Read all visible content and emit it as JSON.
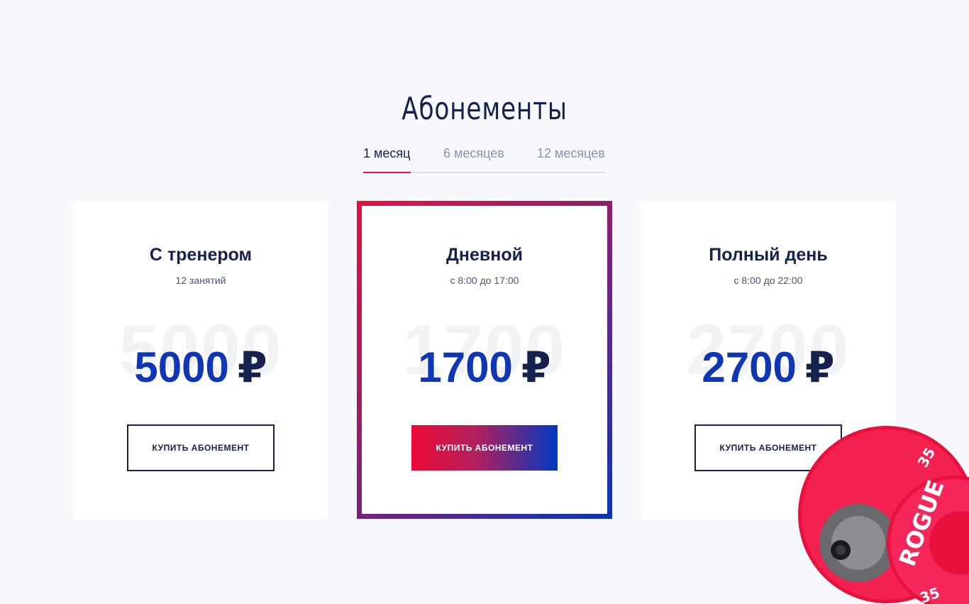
{
  "section": {
    "title": "Абонементы"
  },
  "tabs": [
    {
      "label": "1 месяц",
      "active": true
    },
    {
      "label": "6 месяцев",
      "active": false
    },
    {
      "label": "12 месяцев",
      "active": false
    }
  ],
  "plans": [
    {
      "name": "С тренером",
      "subtitle": "12 занятий",
      "ghost": "5000",
      "price": "5000",
      "currency": "₽",
      "button": "КУПИТЬ АБОНЕМЕНТ",
      "featured": false
    },
    {
      "name": "Дневной",
      "subtitle": "с 8:00 до 17:00",
      "ghost": "1700",
      "price": "1700",
      "currency": "₽",
      "button": "КУПИТЬ АБОНЕМЕНТ",
      "featured": true
    },
    {
      "name": "Полный день",
      "subtitle": "с 8:00 до 22:00",
      "ghost": "2700",
      "price": "2700",
      "currency": "₽",
      "button": "КУПИТЬ АБОНЕМЕНТ",
      "featured": false
    }
  ],
  "decoration": {
    "plate_brand": "ROGUE",
    "plate_weight_1": "35",
    "plate_weight_2": "35"
  },
  "colors": {
    "accent_red": "#e8103d",
    "accent_blue": "#0f37b3",
    "text_dark": "#15224e",
    "background": "#f6f8fc"
  }
}
